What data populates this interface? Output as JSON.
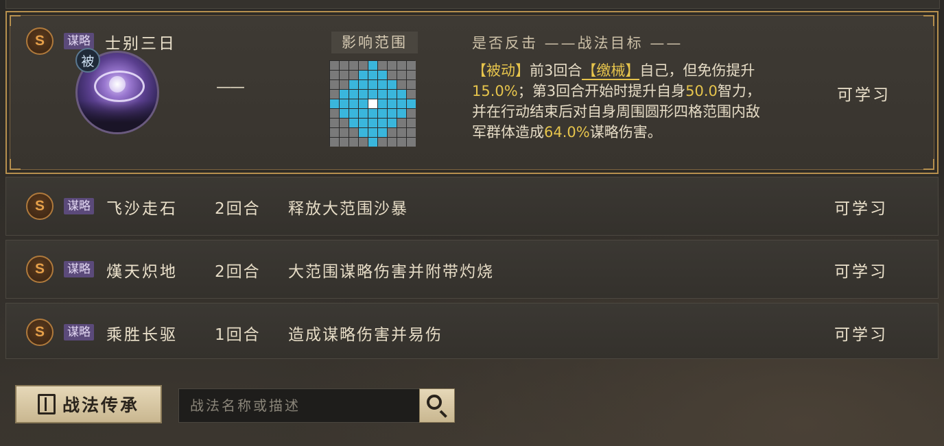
{
  "skills": [
    {
      "grade": "S",
      "type": "谋略",
      "name": "士别三日",
      "passive_badge": "被",
      "turns": "——",
      "range_label": "影响范围",
      "counter_header": "是否反击 ——战法目标 ——",
      "desc_parts": [
        {
          "t": "【被动】",
          "s": "hl"
        },
        {
          "t": "前3回合",
          "s": ""
        },
        {
          "t": "【缴械】",
          "s": "kw"
        },
        {
          "t": "自己，但免伤提升",
          "s": ""
        },
        {
          "t": "15.0%",
          "s": "hl"
        },
        {
          "t": "；第3回合开始时提升自身",
          "s": ""
        },
        {
          "t": "50.0",
          "s": "hl"
        },
        {
          "t": "智力，并在行动结束后对自身周围圆形四格范围内敌军群体造成",
          "s": ""
        },
        {
          "t": "64.0%",
          "s": "hl"
        },
        {
          "t": "谋略伤害。",
          "s": ""
        }
      ],
      "status": "可学习"
    },
    {
      "grade": "S",
      "type": "谋略",
      "name": "飞沙走石",
      "turns": "2回合",
      "desc": "释放大范围沙暴",
      "status": "可学习"
    },
    {
      "grade": "S",
      "type": "谋略",
      "name": "熯天炽地",
      "turns": "2回合",
      "desc": "大范围谋略伤害并附带灼烧",
      "status": "可学习"
    },
    {
      "grade": "S",
      "type": "谋略",
      "name": "乘胜长驱",
      "turns": "1回合",
      "desc": "造成谋略伤害并易伤",
      "status": "可学习"
    }
  ],
  "range_grid": {
    "size": 9,
    "center": [
      4,
      4
    ],
    "radius": 4,
    "on_color": "#3ab6dc",
    "off_color": "#7a7a7a"
  },
  "bottom": {
    "inherit_label": "战法传承",
    "search_placeholder": "战法名称或描述"
  },
  "colors": {
    "accent_gold": "#b7904e",
    "highlight": "#e6c44c",
    "type_tag": "#5b4a7a"
  }
}
